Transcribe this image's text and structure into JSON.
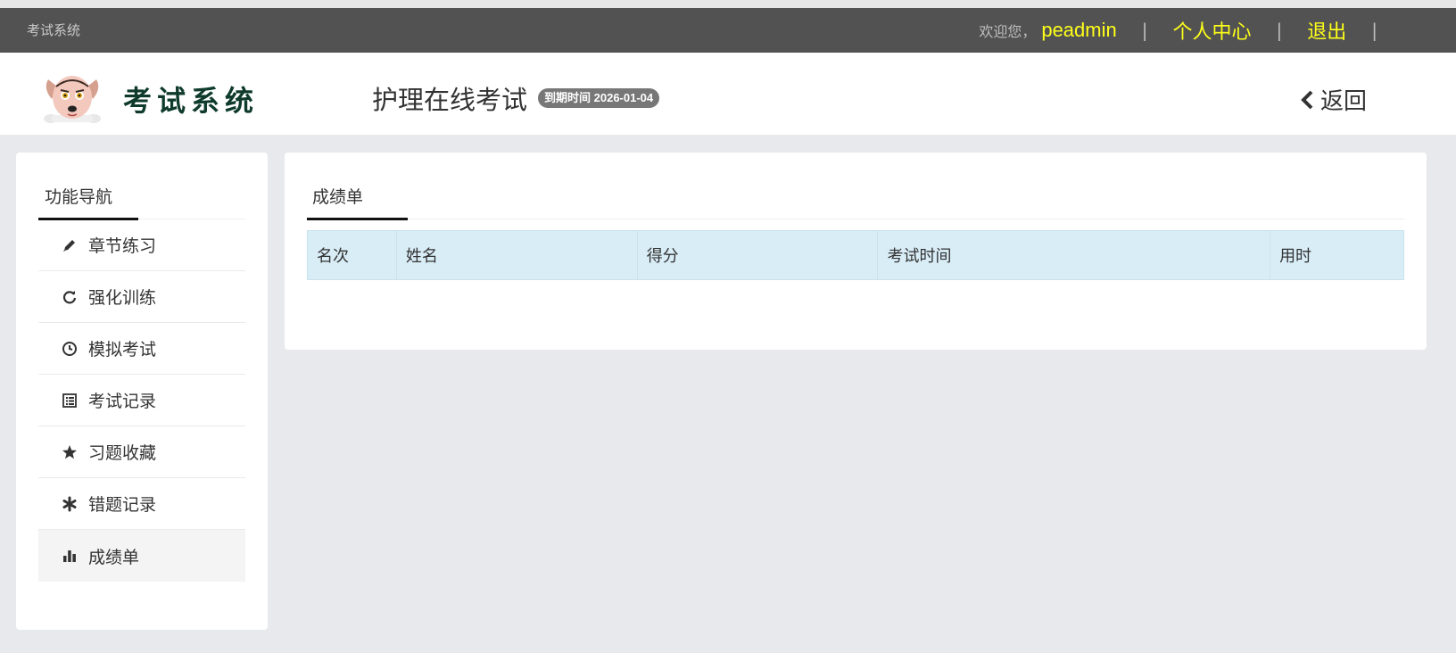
{
  "topbar": {
    "system_label": "考试系统",
    "welcome": "欢迎您，",
    "username": "peadmin",
    "sep1": "|",
    "personal_center": "个人中心",
    "sep2": "|",
    "logout": "退出",
    "sep3": "|"
  },
  "header": {
    "logo_text": "考试系统",
    "exam_title": "护理在线考试",
    "expire_badge": "到期时间 2026-01-04",
    "back_label": "返回"
  },
  "sidebar": {
    "title": "功能导航",
    "items": [
      {
        "label": "章节练习",
        "icon": "pencil-icon"
      },
      {
        "label": "强化训练",
        "icon": "refresh-icon"
      },
      {
        "label": "模拟考试",
        "icon": "clock-icon"
      },
      {
        "label": "考试记录",
        "icon": "list-icon"
      },
      {
        "label": "习题收藏",
        "icon": "star-icon"
      },
      {
        "label": "错题记录",
        "icon": "asterisk-icon"
      },
      {
        "label": "成绩单",
        "icon": "bar-chart-icon",
        "active": true
      }
    ]
  },
  "main": {
    "tab_label": "成绩单",
    "table": {
      "headers": [
        "名次",
        "姓名",
        "得分",
        "考试时间",
        "用时"
      ]
    }
  },
  "colors": {
    "topbar_bg": "#525252",
    "highlight_yellow": "#ffff1a",
    "table_header_bg": "#d9edf7",
    "page_bg": "#e8e9ed"
  }
}
